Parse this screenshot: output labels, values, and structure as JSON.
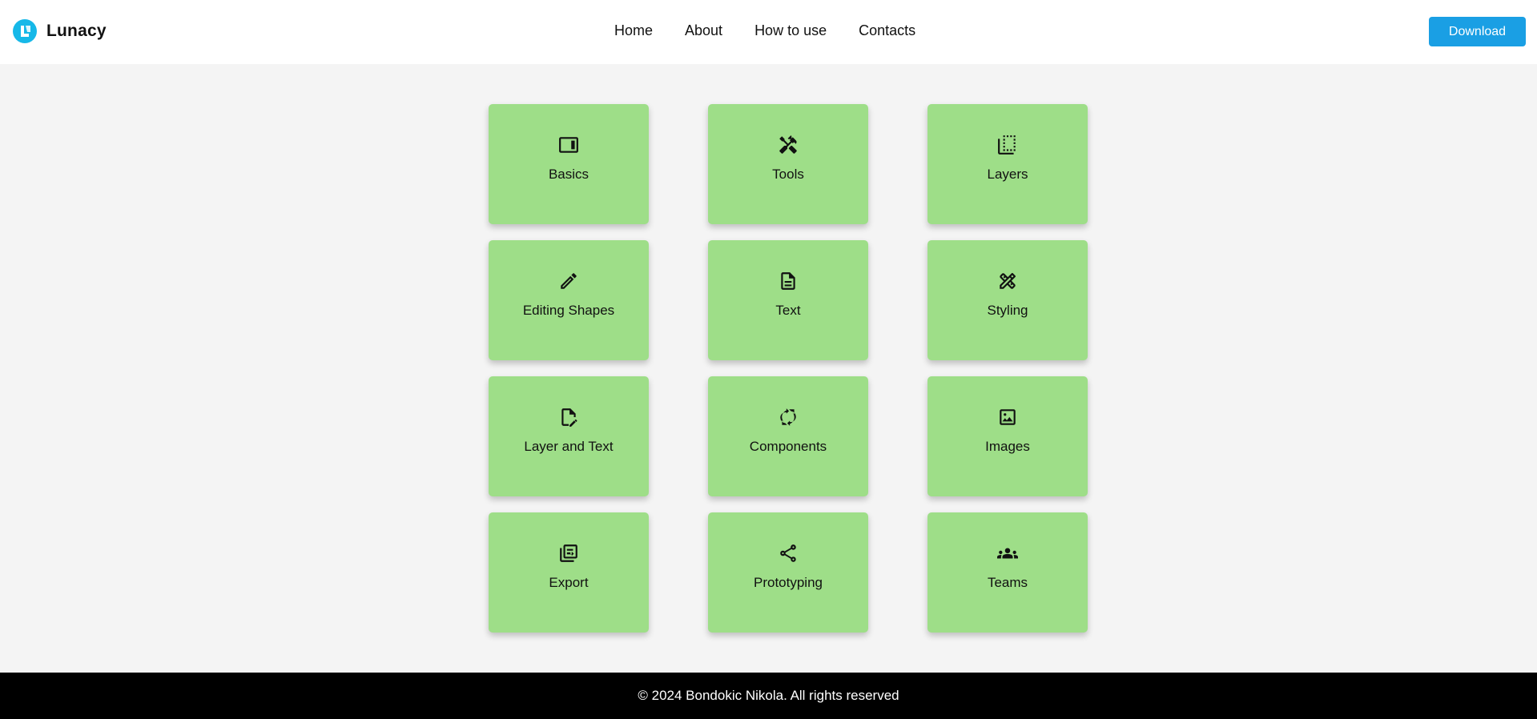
{
  "header": {
    "brand": "Lunacy",
    "nav": [
      "Home",
      "About",
      "How to use",
      "Contacts"
    ],
    "download_label": "Download"
  },
  "colors": {
    "logo": "#16b8e8",
    "card": "#9ede88",
    "download_button": "#1a9fe4",
    "footer": "#000000"
  },
  "cards": [
    {
      "label": "Basics",
      "icon": "video-label-icon"
    },
    {
      "label": "Tools",
      "icon": "tools-icon"
    },
    {
      "label": "Layers",
      "icon": "layers-select-icon"
    },
    {
      "label": "Editing Shapes",
      "icon": "pencil-icon"
    },
    {
      "label": "Text",
      "icon": "document-icon"
    },
    {
      "label": "Styling",
      "icon": "design-services-icon"
    },
    {
      "label": "Layer and Text",
      "icon": "file-edit-icon"
    },
    {
      "label": "Components",
      "icon": "sync-icon"
    },
    {
      "label": "Images",
      "icon": "image-icon"
    },
    {
      "label": "Export",
      "icon": "export-icon"
    },
    {
      "label": "Prototyping",
      "icon": "share-icon"
    },
    {
      "label": "Teams",
      "icon": "groups-icon"
    }
  ],
  "footer": {
    "text": "© 2024 Bondokic Nikola. All rights reserved"
  }
}
